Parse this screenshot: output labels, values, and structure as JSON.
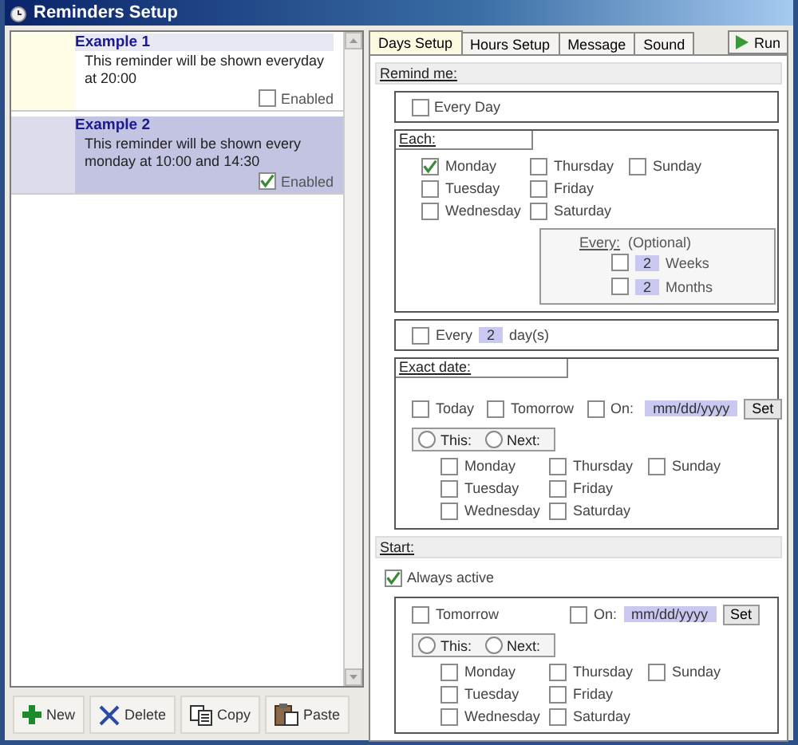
{
  "window": {
    "title": "Reminders Setup"
  },
  "reminders": [
    {
      "title": "Example 1",
      "text": "This reminder will be shown everyday at 20:00",
      "enabled_label": "Enabled",
      "enabled": false,
      "selected": false
    },
    {
      "title": "Example 2",
      "text": "This reminder will be shown every monday at 10:00 and 14:30",
      "enabled_label": "Enabled",
      "enabled": true,
      "selected": true
    }
  ],
  "toolbar": [
    {
      "label": "New",
      "kind": "plus"
    },
    {
      "label": "Delete",
      "kind": "cross"
    },
    {
      "label": "Copy",
      "kind": "copy"
    },
    {
      "label": "Paste",
      "kind": "paste"
    }
  ],
  "tabs": [
    {
      "label": "Days Setup",
      "selected": true
    },
    {
      "label": "Hours Setup",
      "selected": false
    },
    {
      "label": "Message",
      "selected": false
    },
    {
      "label": "Sound",
      "selected": false
    }
  ],
  "run_button": {
    "label": "Run"
  },
  "remind_me": {
    "heading": "Remind me:",
    "every_day": {
      "label": "Every Day",
      "checked": false
    },
    "each": {
      "heading": "Each:",
      "days": [
        {
          "label": "Monday",
          "checked": true
        },
        {
          "label": "Tuesday",
          "checked": false
        },
        {
          "label": "Wednesday",
          "checked": false
        },
        {
          "label": "Thursday",
          "checked": false
        },
        {
          "label": "Friday",
          "checked": false
        },
        {
          "label": "Saturday",
          "checked": false
        },
        {
          "label": "Sunday",
          "checked": false
        }
      ],
      "every": {
        "label": "Every:",
        "hint": "(Optional)",
        "options": [
          {
            "value": "2",
            "label": "Weeks",
            "checked": false
          },
          {
            "value": "2",
            "label": "Months",
            "checked": false
          }
        ]
      }
    },
    "every_n": {
      "prefix": "Every",
      "value": "2",
      "suffix": "day(s)",
      "checked": false
    },
    "exact_date": {
      "heading": "Exact date:",
      "today": {
        "label": "Today",
        "checked": false
      },
      "tomorrow": {
        "label": "Tomorrow",
        "checked": false
      },
      "on": {
        "label": "On:",
        "value": "mm/dd/yyyy",
        "checked": false
      },
      "set_button": "Set",
      "this_next": [
        {
          "label": "This:",
          "selected": false
        },
        {
          "label": "Next:",
          "selected": false
        }
      ],
      "days": [
        {
          "label": "Monday",
          "checked": false
        },
        {
          "label": "Tuesday",
          "checked": false
        },
        {
          "label": "Wednesday",
          "checked": false
        },
        {
          "label": "Thursday",
          "checked": false
        },
        {
          "label": "Friday",
          "checked": false
        },
        {
          "label": "Saturday",
          "checked": false
        },
        {
          "label": "Sunday",
          "checked": false
        }
      ]
    }
  },
  "start": {
    "heading": "Start:",
    "always_active": {
      "label": "Always active",
      "checked": true
    },
    "tomorrow": {
      "label": "Tomorrow",
      "checked": false
    },
    "on": {
      "label": "On:",
      "value": "mm/dd/yyyy",
      "checked": false
    },
    "set_button": "Set",
    "this_next": [
      {
        "label": "This:",
        "selected": false
      },
      {
        "label": "Next:",
        "selected": false
      }
    ],
    "days": [
      {
        "label": "Monday",
        "checked": false
      },
      {
        "label": "Tuesday",
        "checked": false
      },
      {
        "label": "Wednesday",
        "checked": false
      },
      {
        "label": "Thursday",
        "checked": false
      },
      {
        "label": "Friday",
        "checked": false
      },
      {
        "label": "Saturday",
        "checked": false
      },
      {
        "label": "Sunday",
        "checked": false
      }
    ]
  }
}
